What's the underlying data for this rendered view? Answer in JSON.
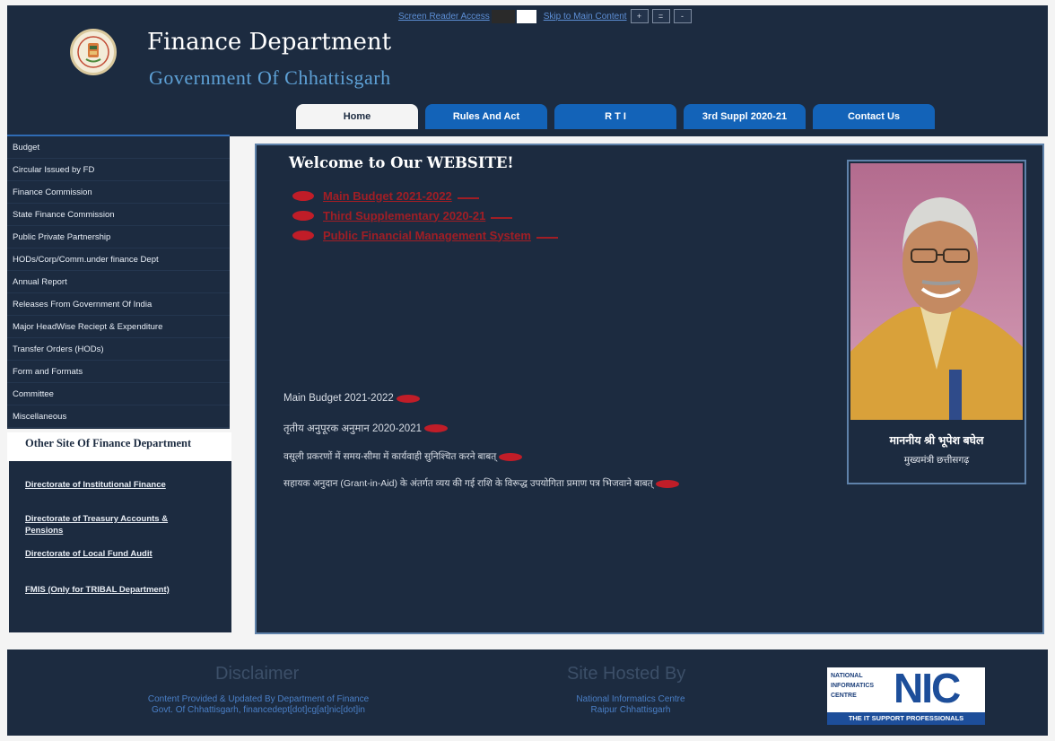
{
  "top_bar": {
    "screen_reader": "Screen Reader Access",
    "skip_main": "Skip to Main Content",
    "font_plus": "+",
    "font_normal": "=",
    "font_minus": "-"
  },
  "header": {
    "title": "Finance Department",
    "subtitle": "Government Of Chhattisgarh"
  },
  "nav": {
    "tabs": [
      {
        "label": "Home",
        "active": true
      },
      {
        "label": "Rules And Act"
      },
      {
        "label": "R T I"
      },
      {
        "label": "3rd Suppl 2020-21"
      },
      {
        "label": "Contact Us"
      }
    ]
  },
  "sidebar": {
    "items": [
      "Budget",
      "Circular Issued by FD",
      "Finance Commission",
      "State Finance Commission",
      "Public Private Partnership",
      "HODs/Corp/Comm.under finance Dept",
      "Annual Report",
      "Releases From Government Of India",
      "Major HeadWise Reciept & Expenditure",
      "Transfer Orders (HODs)",
      "Form and Formats",
      "Committee",
      "Miscellaneous"
    ],
    "other_title": "Other Site Of Finance Department",
    "other_links": [
      "Directorate of Institutional Finance",
      "Directorate of Treasury Accounts & Pensions",
      "Directorate of Local Fund Audit",
      "FMIS (Only for TRIBAL Department)"
    ]
  },
  "main": {
    "welcome": "Welcome to Our WEBSITE!",
    "red_links": [
      "Main Budget 2021-2022",
      "Third Supplementary 2020-21",
      "Public Financial Management System"
    ],
    "notices": [
      "Main Budget 2021-2022",
      "तृतीय अनुपूरक अनुमान 2020-2021",
      "वसूली प्रकरणों में समय-सीमा में कार्यवाही सुनिश्चित करने बाबत्",
      "सहायक अनुदान (Grant-in-Aid) के अंतर्गत व्यय की गई राशि के विरूद्ध उपयोगिता प्रमाण पत्र भिजवाने बाबत्"
    ],
    "cm_name": "माननीय श्री भूपेश बघेल",
    "cm_title": "मुख्यमंत्री छत्तीसगढ़"
  },
  "footer": {
    "disclaimer_head": "Disclaimer",
    "disclaimer_line1": "Content Provided & Updated By Department of Finance",
    "disclaimer_line2": "Govt. Of Chhattisgarh, financedept[dot]cg[at]nic[dot]in",
    "hosted_head": "Site Hosted By",
    "hosted_line1": "National Informatics Centre",
    "hosted_line2": "Raipur Chhattisgarh",
    "nic_small": [
      "NATIONAL",
      "INFORMATICS",
      "CENTRE"
    ],
    "nic_big": "NIC",
    "nic_tagline": "THE IT SUPPORT PROFESSIONALS"
  },
  "colors": {
    "header_bg": "#1c2b40",
    "tab_blue": "#1363b8",
    "link_red": "#a11e25",
    "subtitle_blue": "#5ea1d6"
  }
}
